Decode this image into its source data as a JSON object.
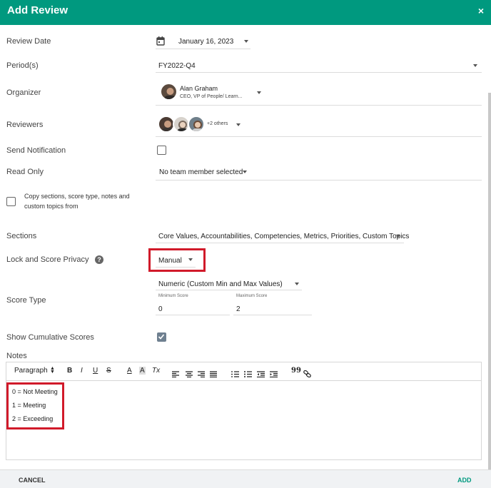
{
  "dialog": {
    "title": "Add Review",
    "close_glyph": "×"
  },
  "fields": {
    "review_date": {
      "label": "Review Date",
      "value": "January 16, 2023"
    },
    "periods": {
      "label": "Period(s)",
      "value": "FY2022-Q4"
    },
    "organizer": {
      "label": "Organizer",
      "name": "Alan Graham",
      "title": "CEO, VP of People/ Learn..."
    },
    "reviewers": {
      "label": "Reviewers",
      "others": "+2 others"
    },
    "send_notification": {
      "label": "Send Notification",
      "checked": false
    },
    "read_only": {
      "label": "Read Only",
      "value": "No team member selected"
    },
    "copy_sections": {
      "label_line1": "Copy sections, score type, notes and",
      "label_line2": "custom topics from",
      "checked": false
    },
    "sections": {
      "label": "Sections",
      "value": "Core Values, Accountabilities, Competencies, Metrics, Priorities, Custom Topics"
    },
    "lock_score_privacy": {
      "label": "Lock and Score Privacy",
      "help_glyph": "?",
      "value": "Manual"
    },
    "score_type": {
      "label": "Score Type",
      "value": "Numeric (Custom Min and Max Values)",
      "min_label": "Minimum Score",
      "min_value": "0",
      "max_label": "Maximum Score",
      "max_value": "2"
    },
    "cumulative_scores": {
      "label": "Show Cumulative Scores",
      "checked": true
    },
    "notes": {
      "label": "Notes"
    }
  },
  "editor": {
    "toolbar": {
      "paragraph": "Paragraph",
      "bold": "B",
      "italic": "I",
      "underline": "U",
      "strike": "S",
      "font_color": "A",
      "highlight": "A",
      "clear_format": "Tx",
      "quote": "99"
    },
    "lines": [
      "0 = Not Meeting",
      "1 = Meeting",
      "2 = Exceeding"
    ]
  },
  "footer": {
    "cancel": "CANCEL",
    "add": "ADD"
  },
  "colors": {
    "header_bg": "#00997f",
    "accent": "#00997f",
    "highlight_box": "#d11a2a"
  },
  "icons": [
    "calendar-icon",
    "close-icon",
    "help-icon",
    "dropdown-caret-icon",
    "bold-icon",
    "italic-icon",
    "underline-icon",
    "strikethrough-icon",
    "link-icon"
  ]
}
